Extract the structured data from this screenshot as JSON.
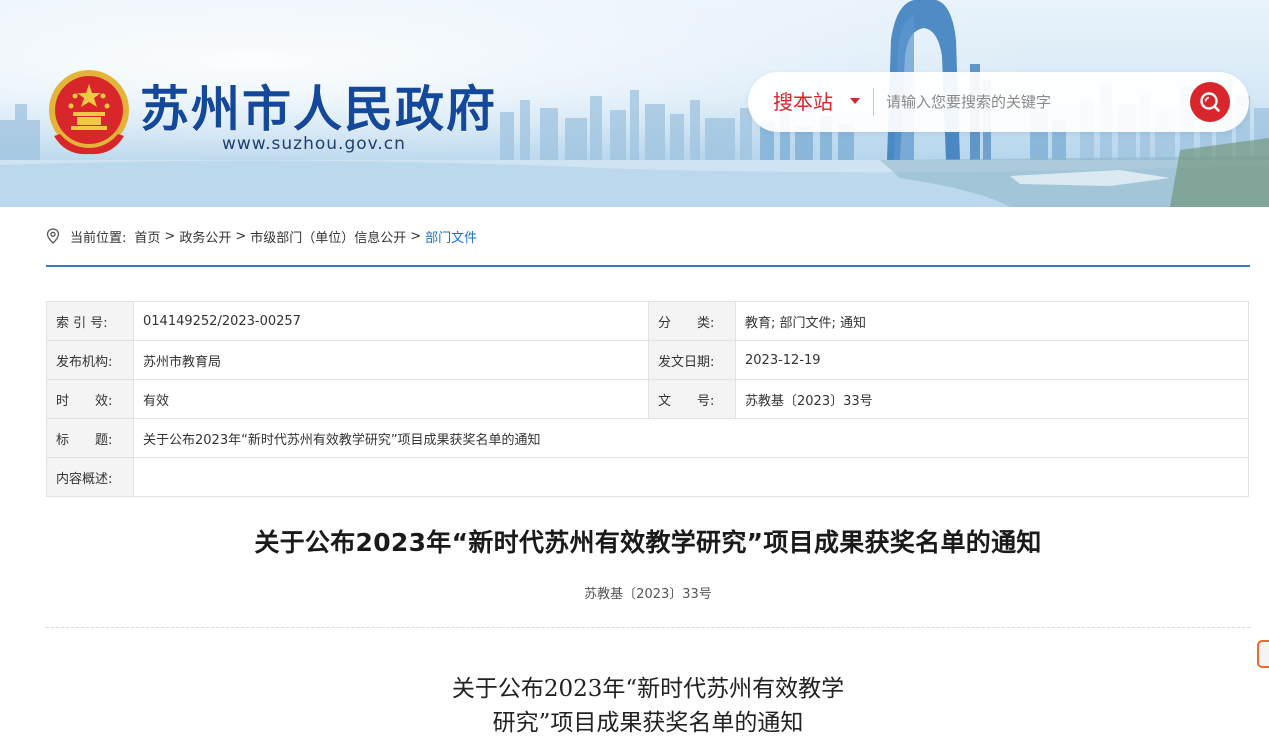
{
  "header": {
    "site_title": "苏州市人民政府",
    "site_url": "www.suzhou.gov.cn",
    "emblem_icon": "national-emblem-icon",
    "brand_color": "#14489a"
  },
  "search": {
    "scope_label": "搜本站",
    "placeholder": "请输入您要搜索的关键字",
    "button_icon": "search-icon",
    "accent_color": "#d9262c"
  },
  "breadcrumb": {
    "prefix": "当前位置:",
    "items": [
      "首页",
      "政务公开",
      "市级部门（单位）信息公开",
      "部门文件"
    ],
    "separator": ">"
  },
  "meta": {
    "rows": [
      {
        "label": "索 引 号:",
        "value": "014149252/2023-00257",
        "label2": "分　　类:",
        "value2": "教育;  部门文件;  通知"
      },
      {
        "label": "发布机构:",
        "value": "苏州市教育局",
        "label2": "发文日期:",
        "value2": "2023-12-19"
      },
      {
        "label": "时　　效:",
        "value": "有效",
        "label2": "文　　号:",
        "value2": "苏教基〔2023〕33号"
      },
      {
        "label": "标　　题:",
        "value": "关于公布2023年“新时代苏州有效教学研究”项目成果获奖名单的通知"
      },
      {
        "label": "内容概述:",
        "value": ""
      }
    ]
  },
  "document": {
    "title": "关于公布2023年“新时代苏州有效教学研究”项目成果获奖名单的通知",
    "number": "苏教基〔2023〕33号",
    "body_title_line1": "关于公布2023年“新时代苏州有效教学",
    "body_title_line2": "研究”项目成果获奖名单的通知"
  }
}
